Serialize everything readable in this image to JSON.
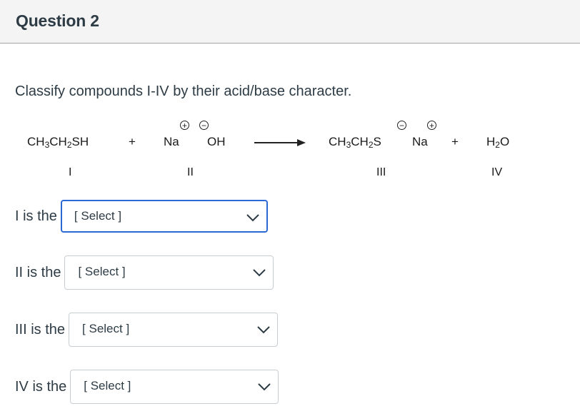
{
  "header": {
    "title": "Question 2"
  },
  "prompt": "Classify compounds I-IV by their acid/base character.",
  "reaction": {
    "reactant1": {
      "parts": [
        "CH",
        "3",
        "CH",
        "2",
        "SH"
      ],
      "label": "I"
    },
    "plus1": "+",
    "reactant2": {
      "cation": "Na",
      "anion": "OH",
      "cation_charge": "+",
      "anion_charge": "−",
      "label": "II"
    },
    "arrow": "right-arrow",
    "product1": {
      "parts": [
        "CH",
        "3",
        "CH",
        "2",
        "S"
      ],
      "counterion": "Na",
      "anion_charge": "−",
      "cation_charge": "+",
      "label": "III"
    },
    "plus2": "+",
    "product2": {
      "parts": [
        "H",
        "2",
        "O"
      ],
      "label": "IV"
    }
  },
  "questions": [
    {
      "label": "I is the",
      "selected": "[ Select ]",
      "focused": true
    },
    {
      "label": "II is the",
      "selected": "[ Select ]",
      "focused": false
    },
    {
      "label": "III is the",
      "selected": "[ Select ]",
      "focused": false
    },
    {
      "label": "IV is the",
      "selected": "[ Select ]",
      "focused": false
    }
  ],
  "colors": {
    "focus": "#2b6ad6",
    "text": "#2d3b45",
    "header_bg": "#f4f4f4"
  }
}
